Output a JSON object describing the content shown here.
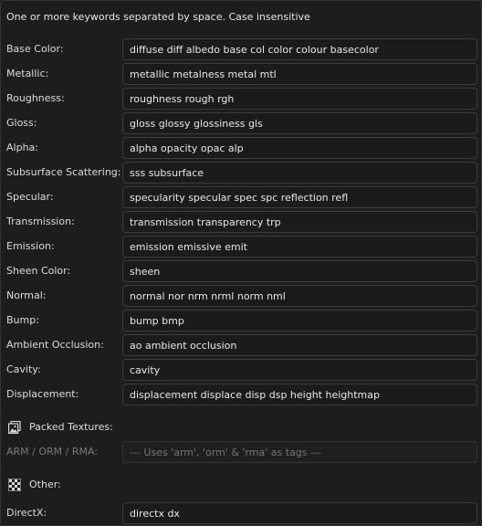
{
  "header": {
    "hint": "One or more keywords separated by space. Case insensitive"
  },
  "keywords": [
    {
      "id": "base-color",
      "label": "Base Color:",
      "value": "diffuse diff albedo base col color colour basecolor"
    },
    {
      "id": "metallic",
      "label": "Metallic:",
      "value": "metallic metalness metal mtl"
    },
    {
      "id": "roughness",
      "label": "Roughness:",
      "value": "roughness rough rgh"
    },
    {
      "id": "gloss",
      "label": "Gloss:",
      "value": "gloss glossy glossiness gls"
    },
    {
      "id": "alpha",
      "label": "Alpha:",
      "value": "alpha opacity opac alp"
    },
    {
      "id": "subsurface-scattering",
      "label": "Subsurface Scattering:",
      "value": "sss subsurface"
    },
    {
      "id": "specular",
      "label": "Specular:",
      "value": "specularity specular spec spc reflection refl"
    },
    {
      "id": "transmission",
      "label": "Transmission:",
      "value": "transmission transparency trp"
    },
    {
      "id": "emission",
      "label": "Emission:",
      "value": "emission emissive emit"
    },
    {
      "id": "sheen-color",
      "label": "Sheen Color:",
      "value": "sheen"
    },
    {
      "id": "normal",
      "label": "Normal:",
      "value": "normal nor nrm nrml norm nml"
    },
    {
      "id": "bump",
      "label": "Bump:",
      "value": "bump bmp"
    },
    {
      "id": "ambient-occlusion",
      "label": "Ambient Occlusion:",
      "value": "ao ambient occlusion"
    },
    {
      "id": "cavity",
      "label": "Cavity:",
      "value": "cavity"
    },
    {
      "id": "displacement",
      "label": "Displacement:",
      "value": "displacement displace disp dsp height heightmap"
    }
  ],
  "packed": {
    "section_label": "Packed Textures:",
    "section_icon": "image-stack-icon",
    "arm_label": "ARM / ORM / RMA:",
    "arm_placeholder": "--- Uses 'arm', 'orm' & 'rma' as tags ---"
  },
  "other": {
    "section_label": "Other:",
    "section_icon": "checker-icon",
    "directx_label": "DirectX:",
    "directx_value": "directx dx"
  }
}
